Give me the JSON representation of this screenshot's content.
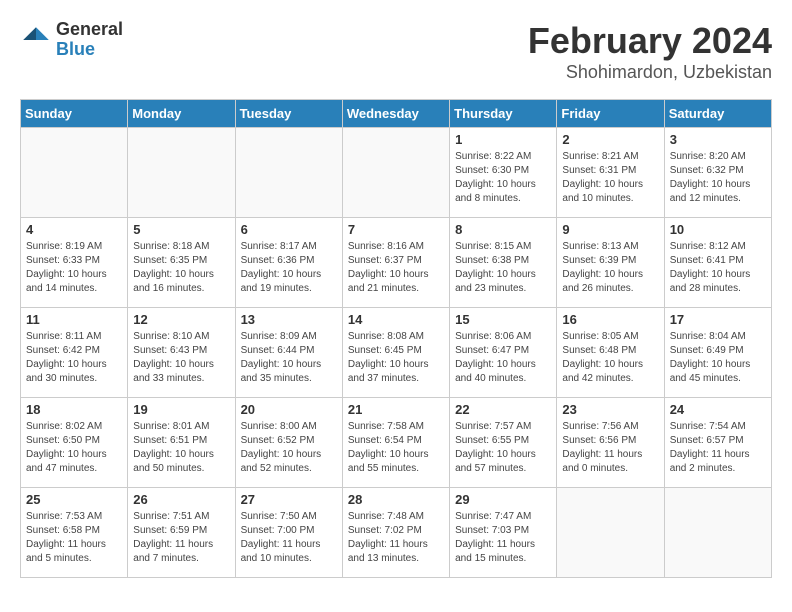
{
  "header": {
    "logo_general": "General",
    "logo_blue": "Blue",
    "month_title": "February 2024",
    "location": "Shohimardon, Uzbekistan"
  },
  "days_of_week": [
    "Sunday",
    "Monday",
    "Tuesday",
    "Wednesday",
    "Thursday",
    "Friday",
    "Saturday"
  ],
  "weeks": [
    [
      {
        "day": "",
        "info": ""
      },
      {
        "day": "",
        "info": ""
      },
      {
        "day": "",
        "info": ""
      },
      {
        "day": "",
        "info": ""
      },
      {
        "day": "1",
        "info": "Sunrise: 8:22 AM\nSunset: 6:30 PM\nDaylight: 10 hours\nand 8 minutes."
      },
      {
        "day": "2",
        "info": "Sunrise: 8:21 AM\nSunset: 6:31 PM\nDaylight: 10 hours\nand 10 minutes."
      },
      {
        "day": "3",
        "info": "Sunrise: 8:20 AM\nSunset: 6:32 PM\nDaylight: 10 hours\nand 12 minutes."
      }
    ],
    [
      {
        "day": "4",
        "info": "Sunrise: 8:19 AM\nSunset: 6:33 PM\nDaylight: 10 hours\nand 14 minutes."
      },
      {
        "day": "5",
        "info": "Sunrise: 8:18 AM\nSunset: 6:35 PM\nDaylight: 10 hours\nand 16 minutes."
      },
      {
        "day": "6",
        "info": "Sunrise: 8:17 AM\nSunset: 6:36 PM\nDaylight: 10 hours\nand 19 minutes."
      },
      {
        "day": "7",
        "info": "Sunrise: 8:16 AM\nSunset: 6:37 PM\nDaylight: 10 hours\nand 21 minutes."
      },
      {
        "day": "8",
        "info": "Sunrise: 8:15 AM\nSunset: 6:38 PM\nDaylight: 10 hours\nand 23 minutes."
      },
      {
        "day": "9",
        "info": "Sunrise: 8:13 AM\nSunset: 6:39 PM\nDaylight: 10 hours\nand 26 minutes."
      },
      {
        "day": "10",
        "info": "Sunrise: 8:12 AM\nSunset: 6:41 PM\nDaylight: 10 hours\nand 28 minutes."
      }
    ],
    [
      {
        "day": "11",
        "info": "Sunrise: 8:11 AM\nSunset: 6:42 PM\nDaylight: 10 hours\nand 30 minutes."
      },
      {
        "day": "12",
        "info": "Sunrise: 8:10 AM\nSunset: 6:43 PM\nDaylight: 10 hours\nand 33 minutes."
      },
      {
        "day": "13",
        "info": "Sunrise: 8:09 AM\nSunset: 6:44 PM\nDaylight: 10 hours\nand 35 minutes."
      },
      {
        "day": "14",
        "info": "Sunrise: 8:08 AM\nSunset: 6:45 PM\nDaylight: 10 hours\nand 37 minutes."
      },
      {
        "day": "15",
        "info": "Sunrise: 8:06 AM\nSunset: 6:47 PM\nDaylight: 10 hours\nand 40 minutes."
      },
      {
        "day": "16",
        "info": "Sunrise: 8:05 AM\nSunset: 6:48 PM\nDaylight: 10 hours\nand 42 minutes."
      },
      {
        "day": "17",
        "info": "Sunrise: 8:04 AM\nSunset: 6:49 PM\nDaylight: 10 hours\nand 45 minutes."
      }
    ],
    [
      {
        "day": "18",
        "info": "Sunrise: 8:02 AM\nSunset: 6:50 PM\nDaylight: 10 hours\nand 47 minutes."
      },
      {
        "day": "19",
        "info": "Sunrise: 8:01 AM\nSunset: 6:51 PM\nDaylight: 10 hours\nand 50 minutes."
      },
      {
        "day": "20",
        "info": "Sunrise: 8:00 AM\nSunset: 6:52 PM\nDaylight: 10 hours\nand 52 minutes."
      },
      {
        "day": "21",
        "info": "Sunrise: 7:58 AM\nSunset: 6:54 PM\nDaylight: 10 hours\nand 55 minutes."
      },
      {
        "day": "22",
        "info": "Sunrise: 7:57 AM\nSunset: 6:55 PM\nDaylight: 10 hours\nand 57 minutes."
      },
      {
        "day": "23",
        "info": "Sunrise: 7:56 AM\nSunset: 6:56 PM\nDaylight: 11 hours\nand 0 minutes."
      },
      {
        "day": "24",
        "info": "Sunrise: 7:54 AM\nSunset: 6:57 PM\nDaylight: 11 hours\nand 2 minutes."
      }
    ],
    [
      {
        "day": "25",
        "info": "Sunrise: 7:53 AM\nSunset: 6:58 PM\nDaylight: 11 hours\nand 5 minutes."
      },
      {
        "day": "26",
        "info": "Sunrise: 7:51 AM\nSunset: 6:59 PM\nDaylight: 11 hours\nand 7 minutes."
      },
      {
        "day": "27",
        "info": "Sunrise: 7:50 AM\nSunset: 7:00 PM\nDaylight: 11 hours\nand 10 minutes."
      },
      {
        "day": "28",
        "info": "Sunrise: 7:48 AM\nSunset: 7:02 PM\nDaylight: 11 hours\nand 13 minutes."
      },
      {
        "day": "29",
        "info": "Sunrise: 7:47 AM\nSunset: 7:03 PM\nDaylight: 11 hours\nand 15 minutes."
      },
      {
        "day": "",
        "info": ""
      },
      {
        "day": "",
        "info": ""
      }
    ]
  ]
}
